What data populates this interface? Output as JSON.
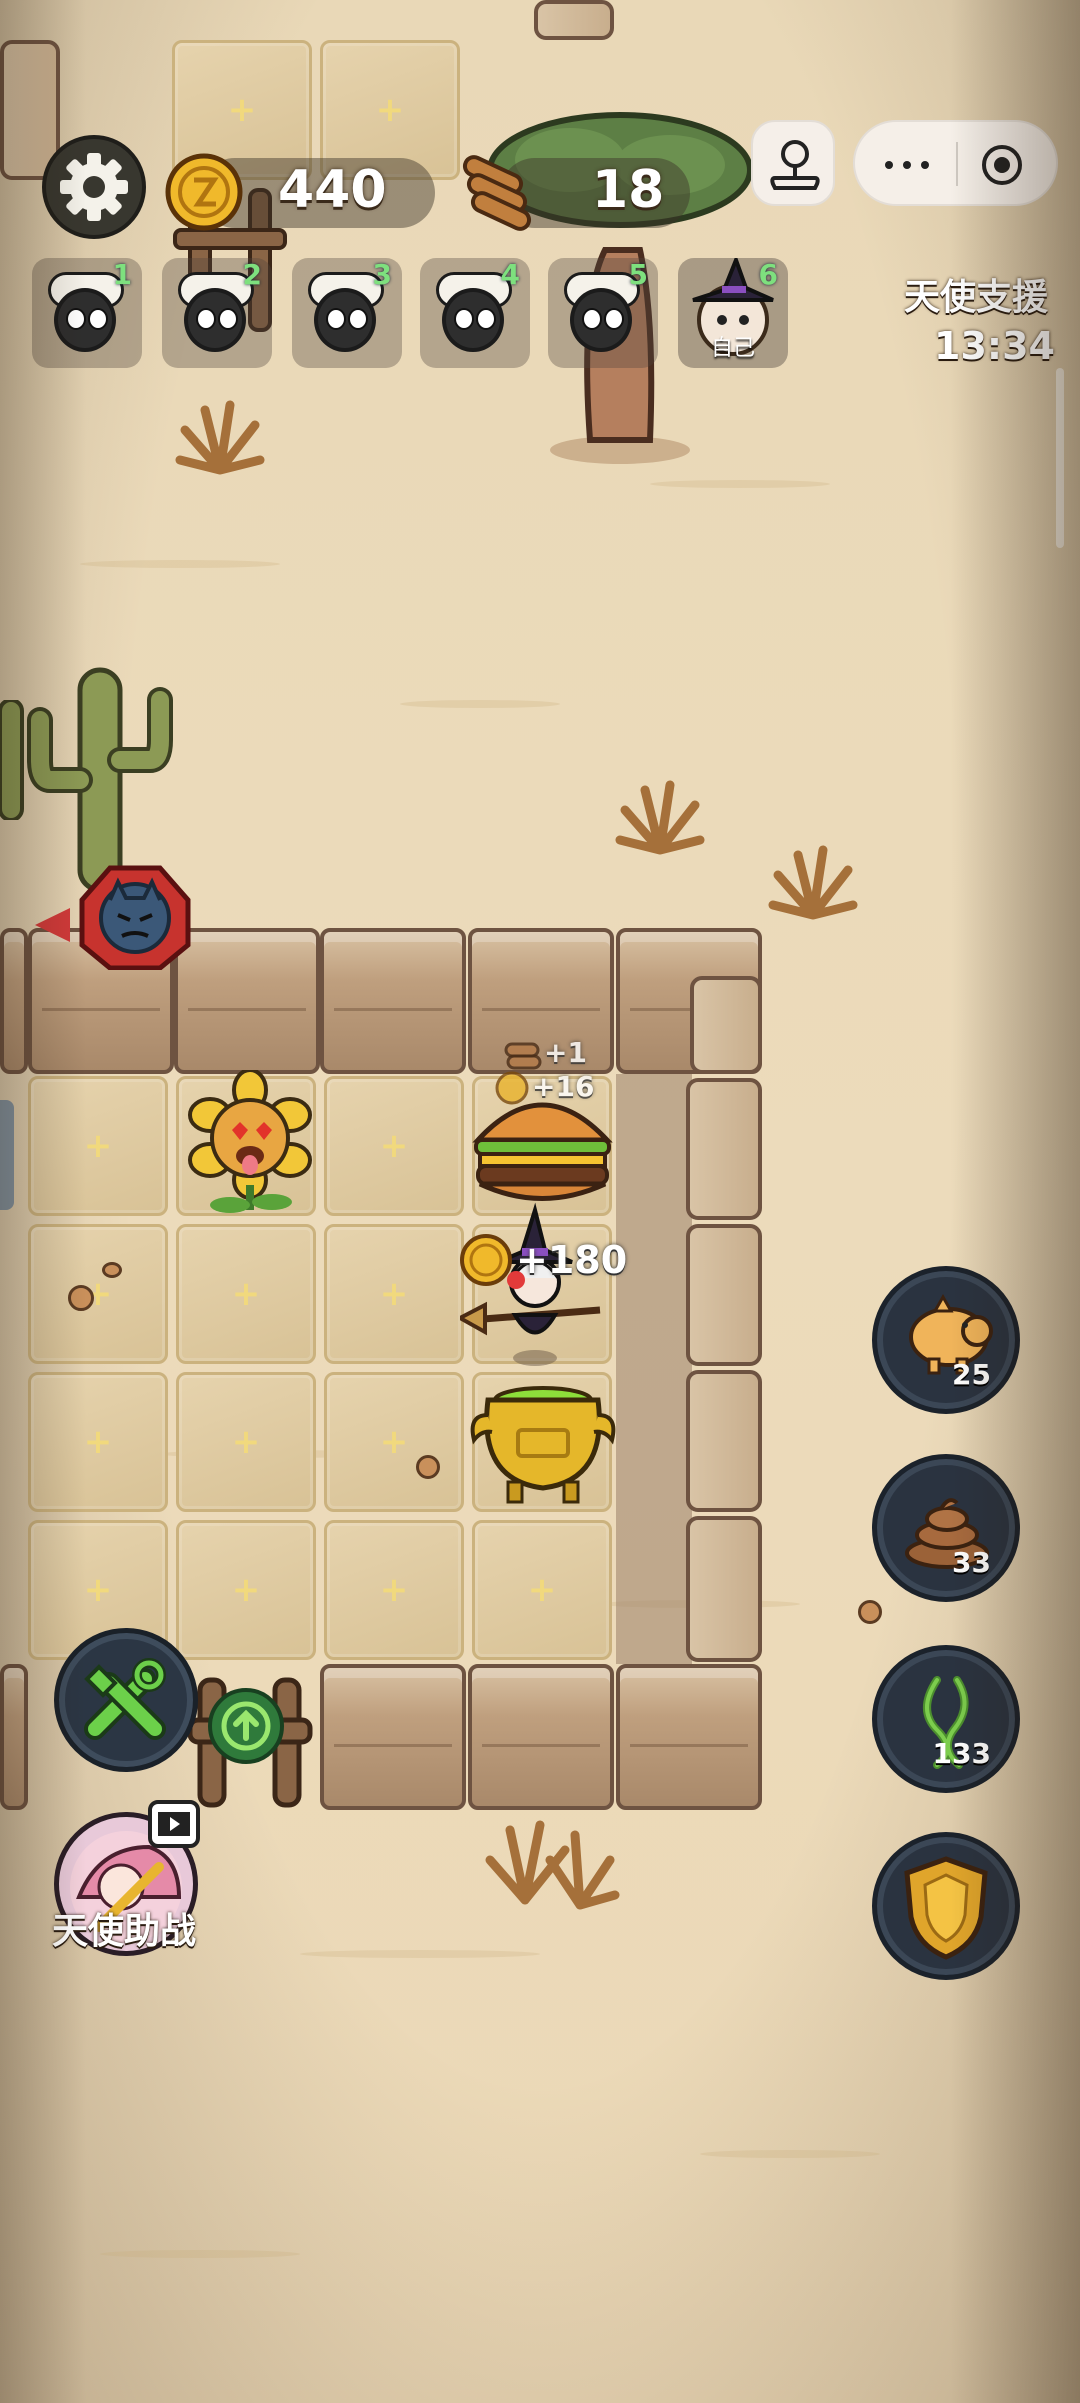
{
  "hud": {
    "coins": "440",
    "wood": "18"
  },
  "players": [
    {
      "num": "1",
      "label": ""
    },
    {
      "num": "2",
      "label": ""
    },
    {
      "num": "3",
      "label": ""
    },
    {
      "num": "4",
      "label": ""
    },
    {
      "num": "5",
      "label": ""
    },
    {
      "num": "6",
      "label": "自己"
    }
  ],
  "angel_support": {
    "title": "天使支援",
    "timer": "13:34"
  },
  "float_texts": {
    "wood_gain": "+1",
    "coin_gain": "+16",
    "big_coin_gain": "+180"
  },
  "side_buttons": {
    "piggy_count": "25",
    "poop_count": "33",
    "vine_count": "133"
  },
  "angel_help_label": "天使助战",
  "colors": {
    "sand": "#ecdbbb",
    "tile": "#e0cba3",
    "wall": "#bf9f7e",
    "hud_text": "#ffffff",
    "player_num": "#7ee07e",
    "side_button": "#2a3340"
  }
}
